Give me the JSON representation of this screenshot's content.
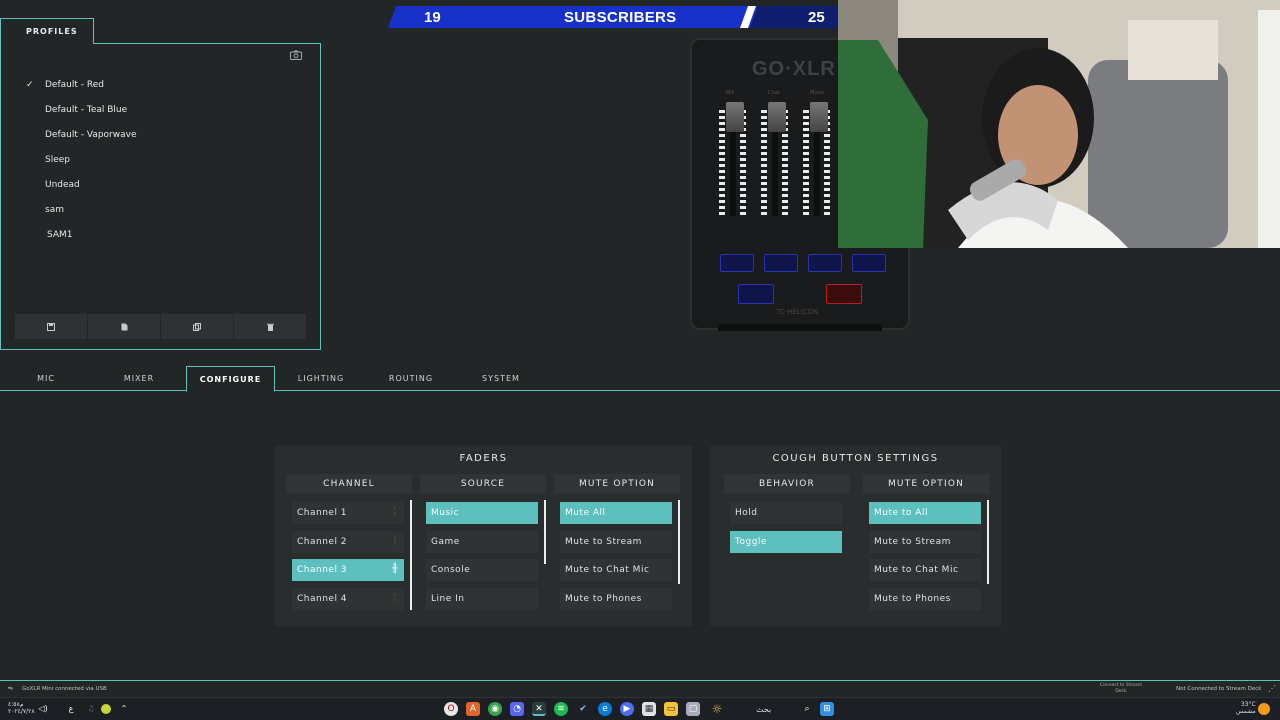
{
  "banner": {
    "left_count": "19",
    "label": "SUBSCRIBERS",
    "right_count": "25"
  },
  "profiles": {
    "tab_label": "PROFILES",
    "items": [
      {
        "label": "Default - Red",
        "checked": true
      },
      {
        "label": "Default - Teal Blue",
        "checked": false
      },
      {
        "label": "Default - Vaporwave",
        "checked": false
      },
      {
        "label": "Sleep",
        "checked": false
      },
      {
        "label": "Undead",
        "checked": false
      },
      {
        "label": "sam",
        "checked": false
      },
      {
        "label": "SAM1",
        "checked": false
      }
    ],
    "actions": [
      "save-icon",
      "new-file-icon",
      "copy-icon",
      "delete-icon"
    ]
  },
  "device": {
    "brand": "GO·XLR",
    "footer": "TC·HELICON",
    "fader_labels": [
      "Mic",
      "Chat",
      "Music"
    ]
  },
  "tabs": [
    {
      "label": "MIC",
      "active": false
    },
    {
      "label": "MIXER",
      "active": false
    },
    {
      "label": "CONFIGURE",
      "active": true
    },
    {
      "label": "LIGHTING",
      "active": false
    },
    {
      "label": "ROUTING",
      "active": false
    },
    {
      "label": "SYSTEM",
      "active": false
    }
  ],
  "faders": {
    "title": "FADERS",
    "channel": {
      "header": "CHANNEL",
      "items": [
        "Channel 1",
        "Channel 2",
        "Channel 3",
        "Channel 4"
      ],
      "selected": 2
    },
    "source": {
      "header": "SOURCE",
      "items": [
        "Music",
        "Game",
        "Console",
        "Line In"
      ],
      "selected": 0
    },
    "mute": {
      "header": "MUTE OPTION",
      "items": [
        "Mute All",
        "Mute to Stream",
        "Mute to Chat Mic",
        "Mute to Phones"
      ],
      "selected": 0
    }
  },
  "cough": {
    "title": "COUGH BUTTON SETTINGS",
    "behavior": {
      "header": "BEHAVIOR",
      "items": [
        "Hold",
        "Toggle"
      ],
      "selected": 1
    },
    "mute": {
      "header": "MUTE OPTION",
      "items": [
        "Mute to All",
        "Mute to Stream",
        "Mute to Chat Mic",
        "Mute to Phones"
      ],
      "selected": 0
    }
  },
  "status": {
    "left": "GoXLR Mini connected via USB",
    "middle": "Connect to Stream Deck",
    "right": "Not Connected to Stream Deck"
  },
  "taskbar": {
    "search_text": "بحث",
    "weather": "33°C",
    "weather_sub": "مشمس",
    "time": "م٤:٥٨",
    "date": "٢٠٢٤/٧/٢٨",
    "lang": "ع"
  },
  "colors": {
    "accent": "#5ebfbf",
    "banner_blue": "#1730c8",
    "bg": "#232626"
  }
}
